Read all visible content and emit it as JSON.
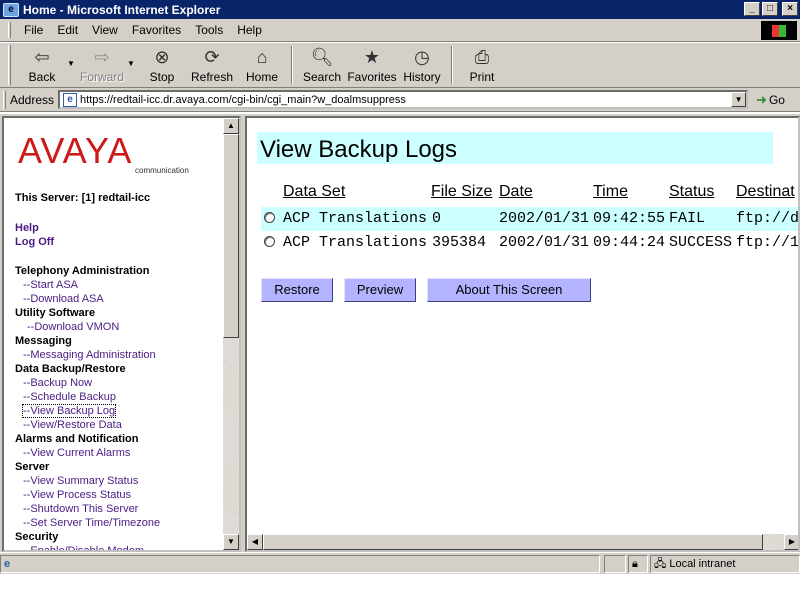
{
  "window": {
    "title": "Home - Microsoft Internet Explorer",
    "icon_name": "ie-icon",
    "controls": [
      "minimize",
      "maximize",
      "close"
    ]
  },
  "menubar": {
    "items": [
      "File",
      "Edit",
      "View",
      "Favorites",
      "Tools",
      "Help"
    ]
  },
  "toolbar": {
    "back": "Back",
    "forward": "Forward",
    "stop": "Stop",
    "refresh": "Refresh",
    "home": "Home",
    "search": "Search",
    "favorites": "Favorites",
    "history": "History",
    "print": "Print"
  },
  "address": {
    "label": "Address",
    "url": "https://redtail-icc.dr.avaya.com/cgi-bin/cgi_main?w_doalmsuppress",
    "go_label": "Go"
  },
  "sidebar": {
    "logo_text": "AVAYA",
    "logo_tagline": "communication",
    "this_server": "This Server: [1] redtail-icc",
    "help": "Help",
    "logoff": "Log Off",
    "sections": [
      {
        "heading": "Telephony Administration",
        "links": [
          "--Start ASA",
          "--Download ASA"
        ]
      },
      {
        "heading": "Utility Software",
        "links": [
          "--Download VMON"
        ]
      },
      {
        "heading": "Messaging",
        "links": [
          "--Messaging Administration"
        ]
      },
      {
        "heading": "Data Backup/Restore",
        "links": [
          "--Backup Now",
          "--Schedule Backup",
          "--View Backup Log",
          "--View/Restore Data"
        ]
      },
      {
        "heading": "Alarms and Notification",
        "links": [
          "--View Current Alarms"
        ]
      },
      {
        "heading": "Server",
        "links": [
          "--View Summary Status",
          "--View Process Status",
          "--Shutdown This Server",
          "--Set Server Time/Timezone"
        ]
      },
      {
        "heading": "Security",
        "links": [
          "--Enable/Disable Modem"
        ]
      }
    ],
    "focused_link": "--View Backup Log"
  },
  "main": {
    "title": "View Backup Logs",
    "columns": [
      "Data Set",
      "File Size",
      "Date",
      "Time",
      "Status",
      "Destinat"
    ],
    "rows": [
      {
        "data_set": "ACP Translations",
        "file_size": "0",
        "date": "2002/01/31",
        "time": "09:42:55",
        "status": "FAIL",
        "destination": "ftp://d"
      },
      {
        "data_set": "ACP Translations",
        "file_size": "395384",
        "date": "2002/01/31",
        "time": "09:44:24",
        "status": "SUCCESS",
        "destination": "ftp://1"
      }
    ],
    "buttons": {
      "restore": "Restore",
      "preview": "Preview",
      "about": "About This Screen"
    }
  },
  "statusbar": {
    "zone": "Local intranet"
  },
  "colors": {
    "titlebar": "#0a246a",
    "highlight": "#ccffff",
    "button": "#b3b3ff",
    "link": "#4a1c83",
    "logo": "#cc1a1a"
  }
}
